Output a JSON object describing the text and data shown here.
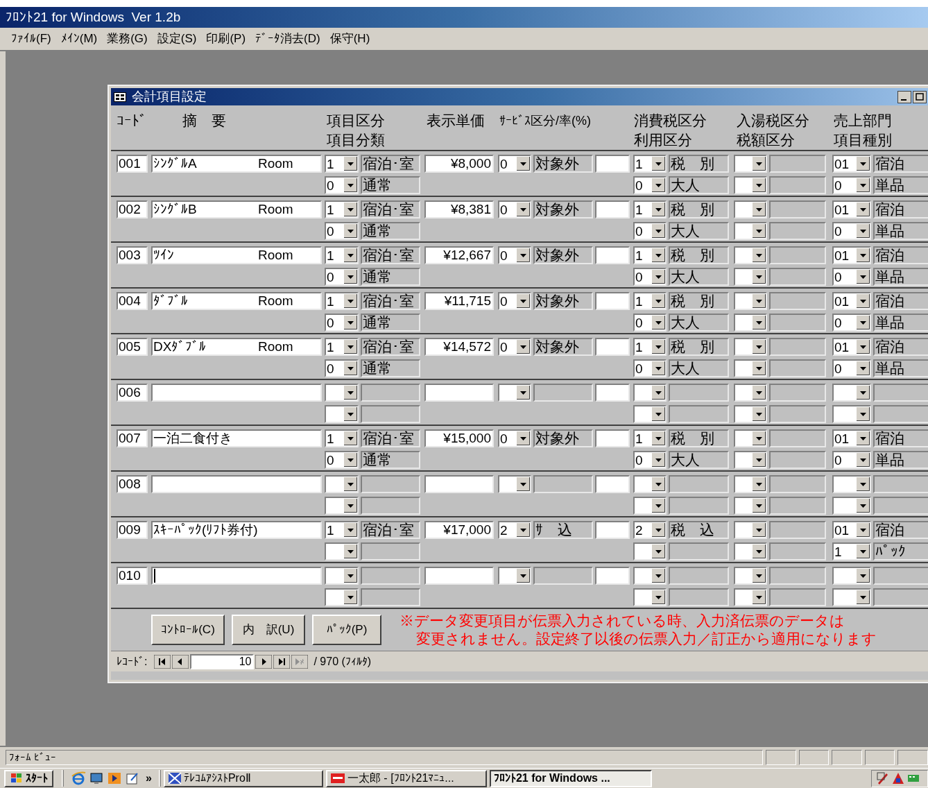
{
  "window": {
    "title": "ﾌﾛﾝﾄ21 for Windows  Ver 1.2b"
  },
  "menu": [
    "ﾌｧｲﾙ(F)",
    "ﾒｲﾝ(M)",
    "業務(G)",
    "設定(S)",
    "印刷(P)",
    "ﾃﾞｰﾀ消去(D)",
    "保守(H)"
  ],
  "form": {
    "title": "会計項目設定",
    "headers": {
      "code": "ｺｰﾄﾞ",
      "name": "摘　要",
      "kubun": "項目区分",
      "bunrui": "項目分類",
      "price": "表示単価",
      "service": "ｻｰﾋﾞｽ区分/率(%)",
      "tax": "消費税区分",
      "riyo": "利用区分",
      "nyuto": "入湯税区分",
      "zeigaku": "税額区分",
      "uriage": "売上部門",
      "shubetsu": "項目種別"
    },
    "records": [
      {
        "code": "001",
        "name": "ｼﾝｸﾞﾙA",
        "suffix": "Room",
        "editing": false,
        "kubun": {
          "value": "1",
          "label": "宿泊･室"
        },
        "bunrui": {
          "value": "0",
          "label": "通常"
        },
        "price": "¥8,000",
        "service": {
          "value": "0",
          "label": "対象外"
        },
        "tax": {
          "value": "1",
          "label": "税　別"
        },
        "riyo": {
          "value": "0",
          "label": "大人"
        },
        "uriage": {
          "value": "01",
          "label": "宿泊"
        },
        "shubetsu": {
          "value": "0",
          "label": "単品"
        }
      },
      {
        "code": "002",
        "name": "ｼﾝｸﾞﾙB",
        "suffix": "Room",
        "editing": false,
        "kubun": {
          "value": "1",
          "label": "宿泊･室"
        },
        "bunrui": {
          "value": "0",
          "label": "通常"
        },
        "price": "¥8,381",
        "service": {
          "value": "0",
          "label": "対象外"
        },
        "tax": {
          "value": "1",
          "label": "税　別"
        },
        "riyo": {
          "value": "0",
          "label": "大人"
        },
        "uriage": {
          "value": "01",
          "label": "宿泊"
        },
        "shubetsu": {
          "value": "0",
          "label": "単品"
        }
      },
      {
        "code": "003",
        "name": "ﾂｲﾝ",
        "suffix": "Room",
        "editing": false,
        "kubun": {
          "value": "1",
          "label": "宿泊･室"
        },
        "bunrui": {
          "value": "0",
          "label": "通常"
        },
        "price": "¥12,667",
        "service": {
          "value": "0",
          "label": "対象外"
        },
        "tax": {
          "value": "1",
          "label": "税　別"
        },
        "riyo": {
          "value": "0",
          "label": "大人"
        },
        "uriage": {
          "value": "01",
          "label": "宿泊"
        },
        "shubetsu": {
          "value": "0",
          "label": "単品"
        }
      },
      {
        "code": "004",
        "name": "ﾀﾞﾌﾞﾙ",
        "suffix": "Room",
        "editing": false,
        "kubun": {
          "value": "1",
          "label": "宿泊･室"
        },
        "bunrui": {
          "value": "0",
          "label": "通常"
        },
        "price": "¥11,715",
        "service": {
          "value": "0",
          "label": "対象外"
        },
        "tax": {
          "value": "1",
          "label": "税　別"
        },
        "riyo": {
          "value": "0",
          "label": "大人"
        },
        "uriage": {
          "value": "01",
          "label": "宿泊"
        },
        "shubetsu": {
          "value": "0",
          "label": "単品"
        }
      },
      {
        "code": "005",
        "name": "DXﾀﾞﾌﾞﾙ",
        "suffix": "Room",
        "editing": false,
        "kubun": {
          "value": "1",
          "label": "宿泊･室"
        },
        "bunrui": {
          "value": "0",
          "label": "通常"
        },
        "price": "¥14,572",
        "service": {
          "value": "0",
          "label": "対象外"
        },
        "tax": {
          "value": "1",
          "label": "税　別"
        },
        "riyo": {
          "value": "0",
          "label": "大人"
        },
        "uriage": {
          "value": "01",
          "label": "宿泊"
        },
        "shubetsu": {
          "value": "0",
          "label": "単品"
        }
      },
      {
        "code": "006",
        "editing": false
      },
      {
        "code": "007",
        "name": "一泊二食付き",
        "editing": false,
        "kubun": {
          "value": "1",
          "label": "宿泊･室"
        },
        "bunrui": {
          "value": "0",
          "label": "通常"
        },
        "price": "¥15,000",
        "service": {
          "value": "0",
          "label": "対象外"
        },
        "tax": {
          "value": "1",
          "label": "税　別"
        },
        "riyo": {
          "value": "0",
          "label": "大人"
        },
        "uriage": {
          "value": "01",
          "label": "宿泊"
        },
        "shubetsu": {
          "value": "0",
          "label": "単品"
        }
      },
      {
        "code": "008",
        "editing": false
      },
      {
        "code": "009",
        "name": "ｽｷｰﾊﾟｯｸ(ﾘﾌﾄ券付)",
        "editing": false,
        "kubun": {
          "value": "1",
          "label": "宿泊･室"
        },
        "price": "¥17,000",
        "service": {
          "value": "2",
          "label": "ｻ　込"
        },
        "tax": {
          "value": "2",
          "label": "税　込"
        },
        "uriage": {
          "value": "01",
          "label": "宿泊"
        },
        "shubetsu": {
          "value": "1",
          "label": "ﾊﾟｯｸ"
        }
      },
      {
        "code": "010",
        "editing": true
      }
    ],
    "buttons": [
      "ｺﾝﾄﾛｰﾙ(C)",
      "内　訳(U)",
      "ﾊﾟｯｸ(P)"
    ],
    "notice": [
      "※データ変更項目が伝票入力されている時、入力済伝票のデータは",
      "変更されません。設定終了以後の伝票入力／訂正から適用になります"
    ],
    "navigator": {
      "label": "ﾚｺｰﾄﾞ:",
      "current": "10",
      "total": "/ 970 (ﾌｨﾙﾀ)"
    }
  },
  "status_bar": {
    "text": "ﾌｫｰﾑ ﾋﾞｭｰ"
  },
  "taskbar": {
    "start": "ｽﾀｰﾄ",
    "chevron": "»",
    "tasks": [
      {
        "label": "ﾃﾚｺﾑｱｼｽﾄProⅡ",
        "selected": false
      },
      {
        "label": "一太郎 - [ﾌﾛﾝﾄ21ﾏﾆｭ...",
        "selected": false
      },
      {
        "label": "ﾌﾛﾝﾄ21 for Windows ...",
        "selected": true
      }
    ]
  }
}
